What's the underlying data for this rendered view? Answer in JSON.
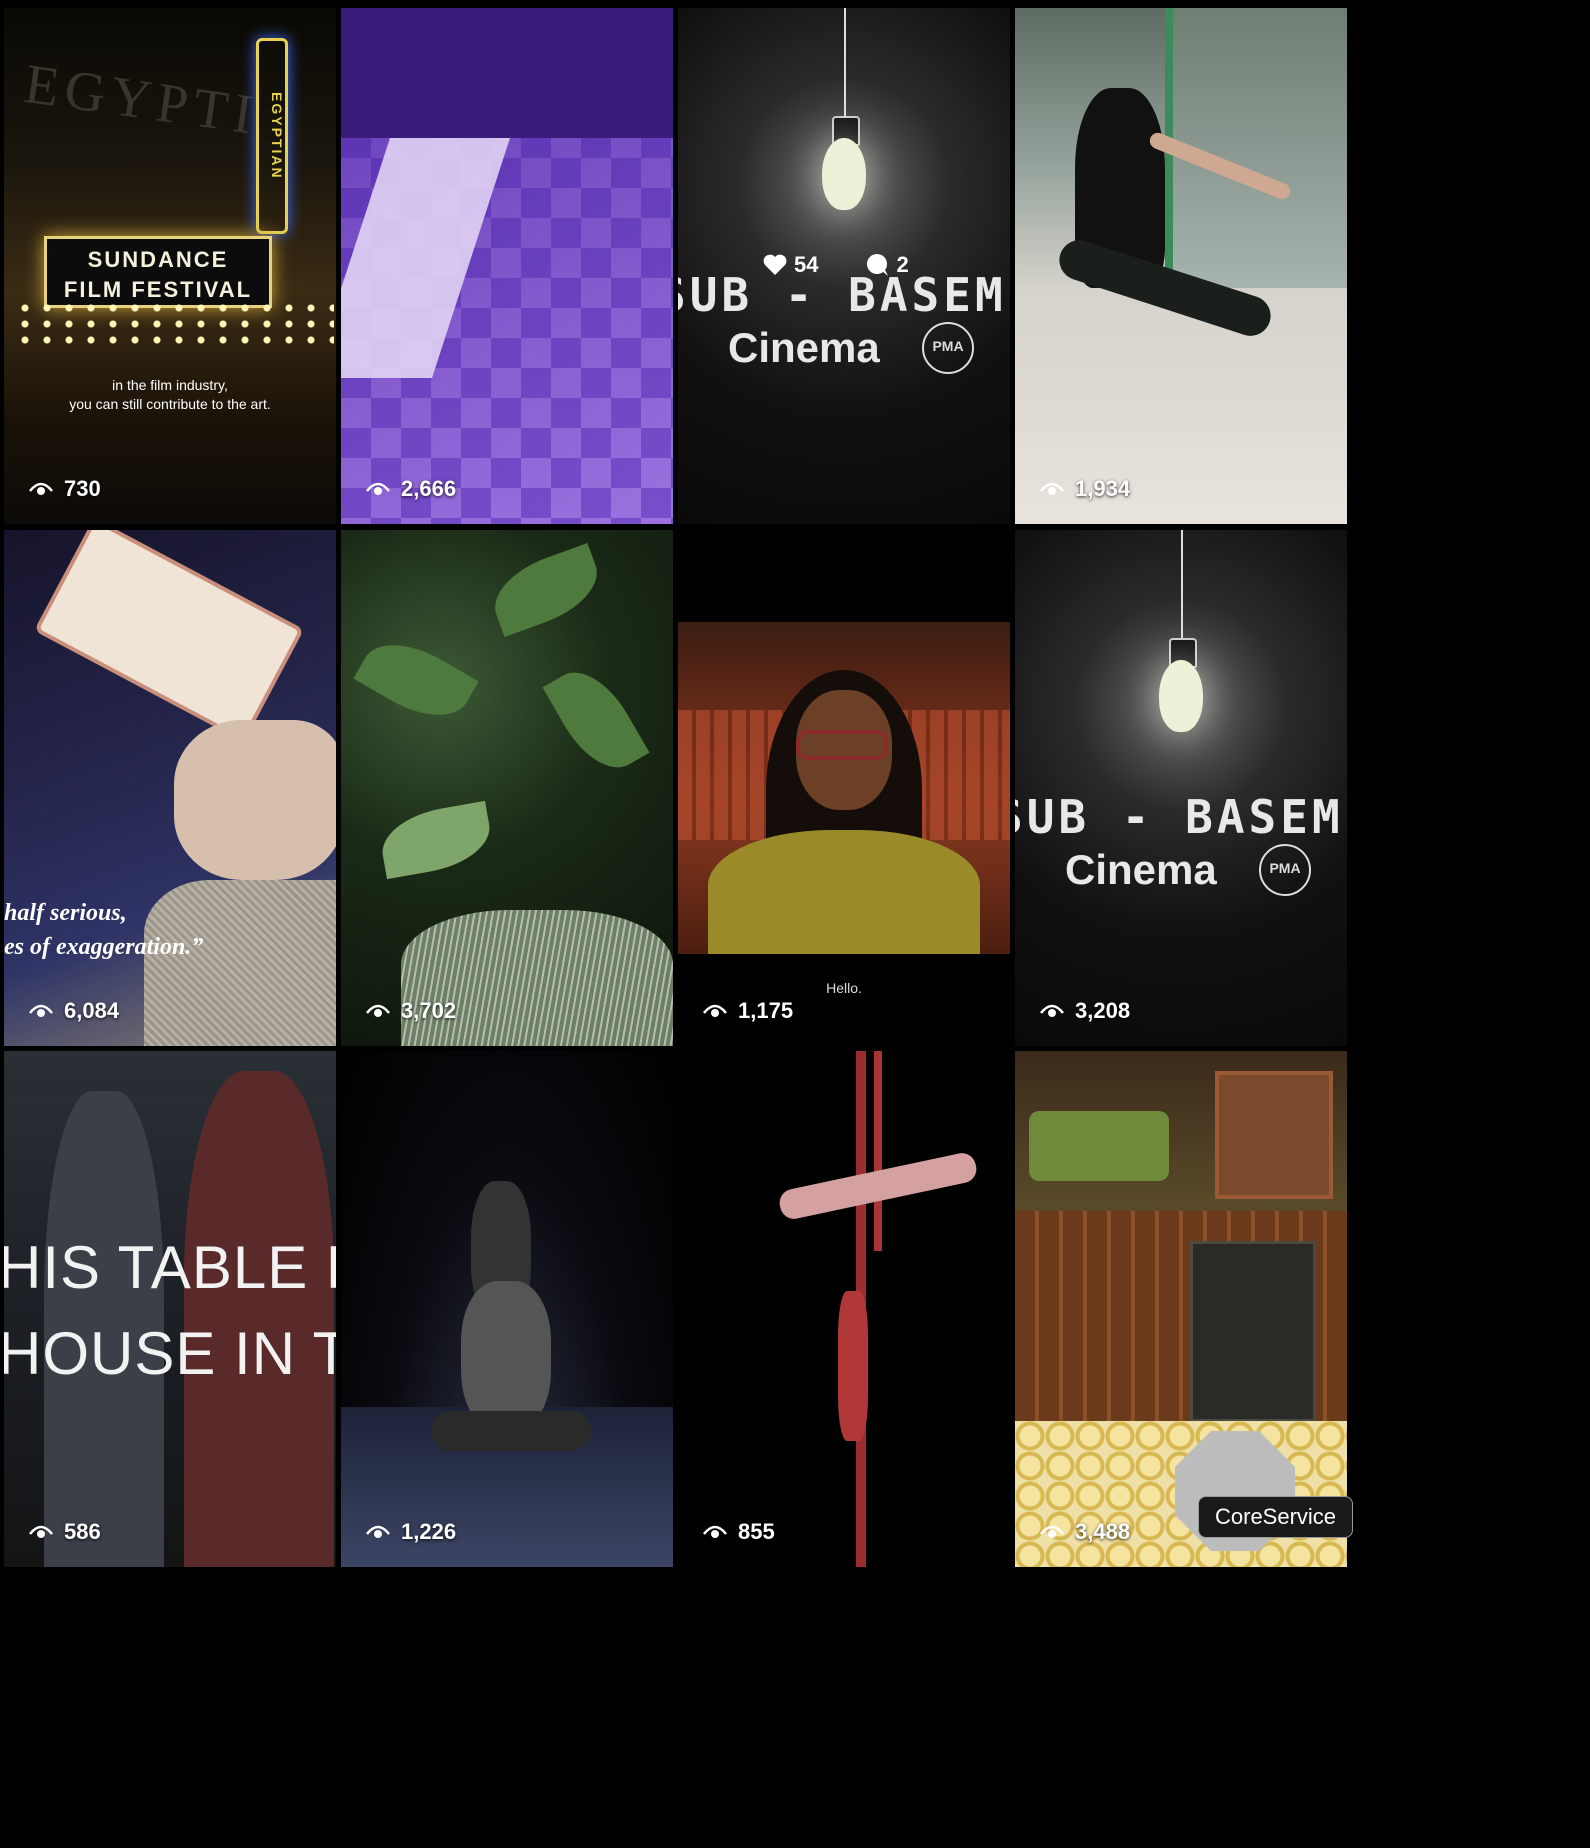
{
  "tiles": [
    {
      "views": "730",
      "text": {
        "line1": "in the film industry,",
        "line2": "you can still contribute to the art.",
        "marquee1": "SUNDANCE",
        "marquee2": "FILM FESTIVAL",
        "sign": "EGYPTIAN",
        "facade": "EGYPTI"
      }
    },
    {
      "views": "2,666"
    },
    {
      "likes": "54",
      "comments": "2",
      "title1": "SUB - BASEMENT",
      "title2": "Cinema",
      "logo": "PMA"
    },
    {
      "views": "1,934"
    },
    {
      "views": "6,084",
      "quote1": "half serious,",
      "quote2": "es of exaggeration.”"
    },
    {
      "views": "3,702"
    },
    {
      "views": "1,175",
      "caption": "Hello."
    },
    {
      "views": "3,208",
      "title1": "SUB - BASEMENT",
      "title2": "Cinema",
      "logo": "PMA"
    },
    {
      "views": "586",
      "big1": "HIS TABLE HA",
      "big2": "HOUSE IN T"
    },
    {
      "views": "1,226"
    },
    {
      "views": "855"
    },
    {
      "views": "3,488"
    }
  ],
  "tooltip": "CoreService",
  "icons": {
    "views": "eye-icon",
    "likes": "heart-icon",
    "comments": "comment-icon"
  },
  "colors": {
    "background": "#000000",
    "marquee_border": "#e7d47a"
  }
}
